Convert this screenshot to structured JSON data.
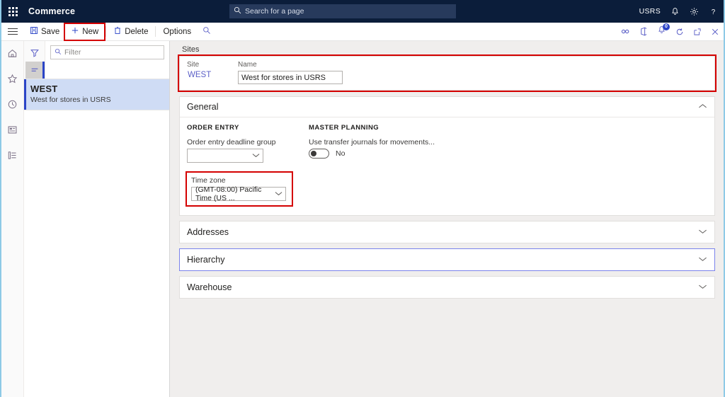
{
  "topnav": {
    "waffle_icon": "app-launcher-icon",
    "app_title": "Commerce",
    "search_placeholder": "Search for a page",
    "search_icon": "search-icon",
    "company": "USRS",
    "notifications_icon": "bell-icon",
    "settings_icon": "gear-icon",
    "help_icon": "question-icon"
  },
  "commandbar": {
    "menu_icon": "hamburger-icon",
    "save_label": "Save",
    "save_icon": "save-icon",
    "new_label": "New",
    "new_icon": "plus-icon",
    "delete_label": "Delete",
    "delete_icon": "trash-icon",
    "options_label": "Options",
    "search_icon": "search-icon",
    "right_icons": {
      "attach_icon": "link-icon",
      "office_icon": "office-icon",
      "notify_icon": "bell-icon",
      "notify_badge": "0",
      "refresh_icon": "refresh-icon",
      "popout_icon": "popout-icon",
      "close_icon": "close-icon"
    }
  },
  "rail": {
    "items": [
      {
        "icon": "home-icon",
        "name": "home"
      },
      {
        "icon": "star-icon",
        "name": "favorites"
      },
      {
        "icon": "clock-icon",
        "name": "recent"
      },
      {
        "icon": "workspace-icon",
        "name": "workspaces"
      },
      {
        "icon": "list-icon",
        "name": "modules"
      }
    ]
  },
  "listpane": {
    "filter_tool_icon": "funnel-icon",
    "list_tool_icon": "lines-icon",
    "filter_placeholder": "Filter",
    "filter_icon": "search-icon",
    "items": [
      {
        "title": "WEST",
        "subtitle": "West for stores in USRS",
        "selected": true
      }
    ]
  },
  "content": {
    "panel_title": "Sites",
    "sites": {
      "site_label": "Site",
      "site_value": "WEST",
      "name_label": "Name",
      "name_value": "West for stores in USRS",
      "highlight_color": "#d40000"
    },
    "general": {
      "title": "General",
      "expanded": true,
      "chevron": "chevron-up-icon",
      "order_entry": {
        "group_title": "ORDER ENTRY",
        "deadline_label": "Order entry deadline group",
        "deadline_value": "",
        "timezone_label": "Time zone",
        "timezone_value": "(GMT-08:00) Pacific Time (US ...",
        "highlight_color": "#d40000"
      },
      "master_planning": {
        "group_title": "MASTER PLANNING",
        "transfer_label": "Use transfer journals for movements...",
        "transfer_value": "No",
        "transfer_on": false
      }
    },
    "sections": [
      {
        "title": "Addresses",
        "chevron": "chevron-down-icon",
        "focused": false
      },
      {
        "title": "Hierarchy",
        "chevron": "chevron-down-icon",
        "focused": true
      },
      {
        "title": "Warehouse",
        "chevron": "chevron-down-icon",
        "focused": false
      }
    ]
  }
}
